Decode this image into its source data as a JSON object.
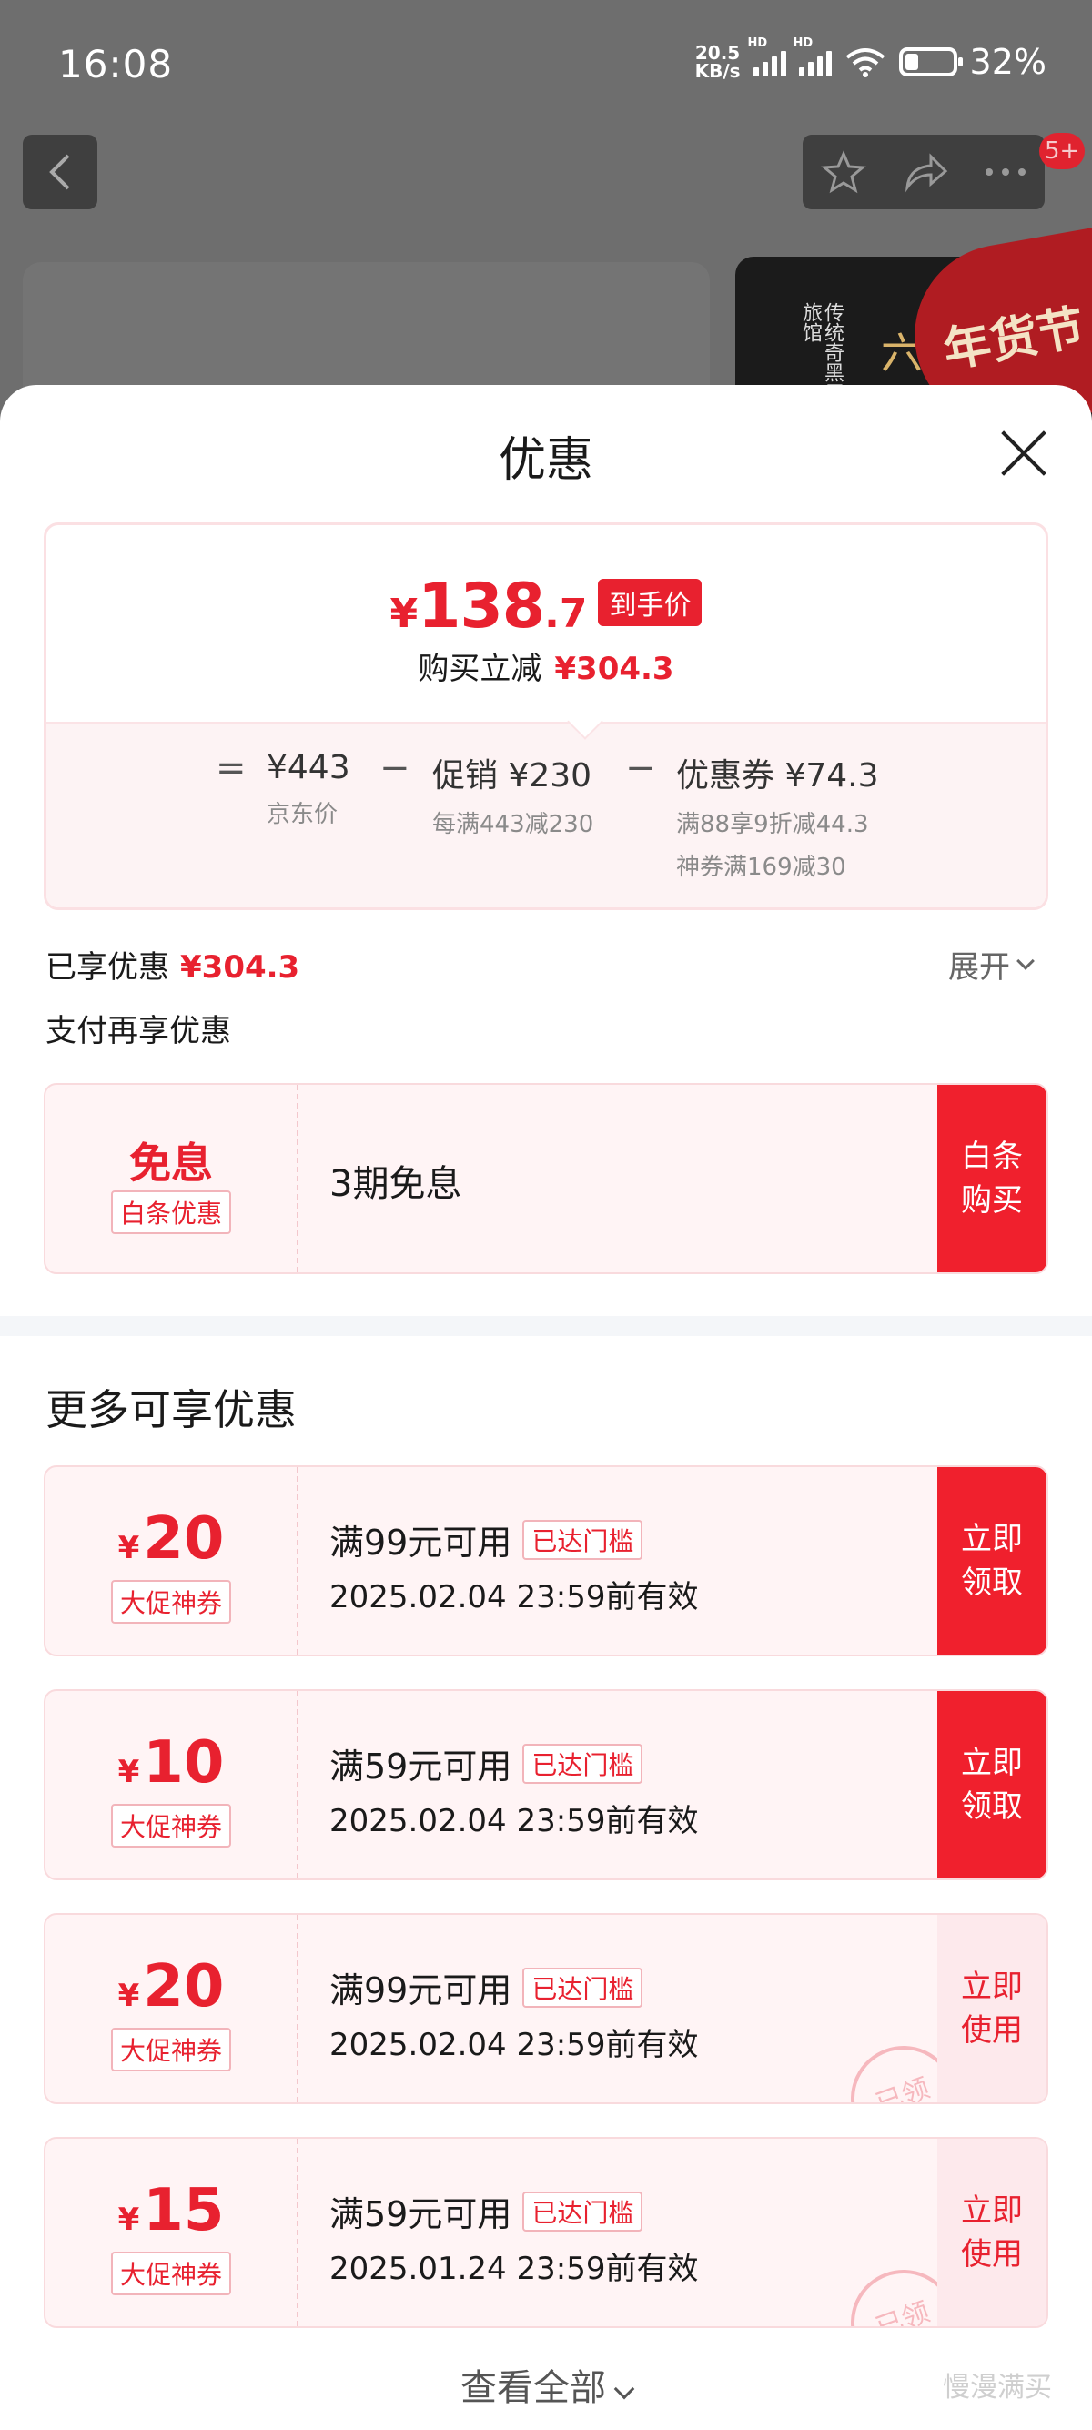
{
  "status_bar": {
    "time": "16:08",
    "net_speed_value": "20.5",
    "net_speed_unit": "KB/s",
    "hd_label": "HD",
    "battery": "32%"
  },
  "background_page": {
    "badge": "5+",
    "festival_text": "年货节",
    "banner_text": "传统奇黑用茶旅馆",
    "banner_big": "六"
  },
  "sheet": {
    "title": "优惠",
    "price_summary": {
      "final_yen": "¥",
      "final_int": "138",
      "final_dec": ".7",
      "final_tag": "到手价",
      "instant_label": "购买立减",
      "instant_value": "¥304.3",
      "eq": "=",
      "minus": "−",
      "jd_price": "¥443",
      "jd_price_label": "京东价",
      "promo": "促销 ¥230",
      "promo_note": "每满443减230",
      "coupon": "优惠券 ¥74.3",
      "coupon_note_1": "满88享9折减44.3",
      "coupon_note_2": "神券满169减30"
    },
    "enjoyed_label": "已享优惠",
    "enjoyed_value": "¥304.3",
    "expand_label": "展开",
    "pay_again_label": "支付再享优惠",
    "baitiao": {
      "big": "免息",
      "tag": "白条优惠",
      "desc": "3期免息",
      "button_line1": "白条",
      "button_line2": "购买"
    },
    "more_title": "更多可享优惠",
    "coupons": [
      {
        "yen": "¥",
        "amount": "20",
        "tag": "大促神券",
        "condition": "满99元可用",
        "reached": "已达门槛",
        "valid": "2025.02.04 23:59前有效",
        "btn1": "立即",
        "btn2": "领取",
        "claimed": false
      },
      {
        "yen": "¥",
        "amount": "10",
        "tag": "大促神券",
        "condition": "满59元可用",
        "reached": "已达门槛",
        "valid": "2025.02.04 23:59前有效",
        "btn1": "立即",
        "btn2": "领取",
        "claimed": false
      },
      {
        "yen": "¥",
        "amount": "20",
        "tag": "大促神券",
        "condition": "满99元可用",
        "reached": "已达门槛",
        "valid": "2025.02.04 23:59前有效",
        "btn1": "立即",
        "btn2": "使用",
        "claimed": true,
        "stamp": "已领"
      },
      {
        "yen": "¥",
        "amount": "15",
        "tag": "大促神券",
        "condition": "满59元可用",
        "reached": "已达门槛",
        "valid": "2025.01.24 23:59前有效",
        "btn1": "立即",
        "btn2": "使用",
        "claimed": true,
        "stamp": "已领"
      }
    ],
    "view_all": "查看全部",
    "watermark": "慢漫满买"
  },
  "colors": {
    "accent_red": "#e8212f",
    "button_red": "#f0202d",
    "coupon_bg": "#fff4f5",
    "light_button_bg": "#fde9ec"
  }
}
